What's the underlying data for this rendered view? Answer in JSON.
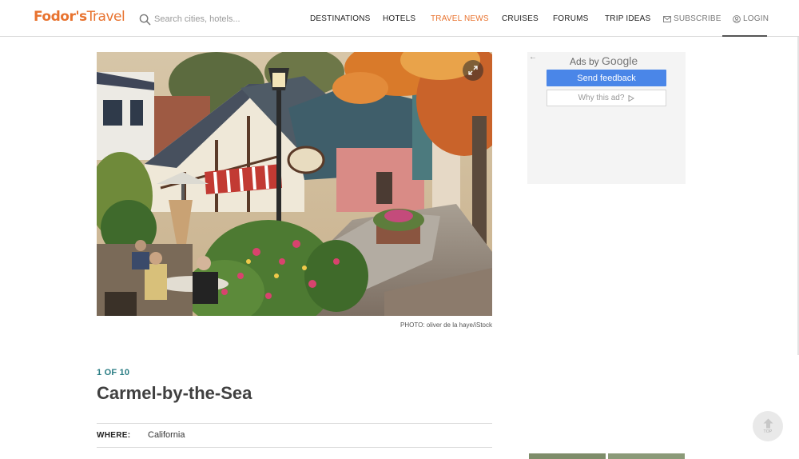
{
  "header": {
    "logo_brand": "Fodor's",
    "logo_suffix": "Travel",
    "search_placeholder": "Search cities, hotels...",
    "nav": [
      {
        "label": "DESTINATIONS"
      },
      {
        "label": "HOTELS"
      },
      {
        "label": "TRAVEL NEWS"
      },
      {
        "label": "CRUISES"
      },
      {
        "label": "FORUMS"
      },
      {
        "label": "TRIP IDEAS"
      }
    ],
    "subscribe_label": "SUBSCRIBE",
    "login_label": "LOGIN",
    "active_nav": "TRAVEL NEWS",
    "accent_color": "#e8732f"
  },
  "article": {
    "photo_credit": "PHOTO: oliver de la haye/iStock",
    "counter": "1 OF 10",
    "title": "Carmel-by-the-Sea",
    "where_label": "WHERE:",
    "where_value": "California",
    "counter_color": "#2a7d84"
  },
  "ad": {
    "ads_by": "Ads by",
    "google": "Google",
    "feedback_label": "Send feedback",
    "why_label": "Why this ad?",
    "button_color": "#4a86e8"
  },
  "back_to_top_label": "TOP"
}
